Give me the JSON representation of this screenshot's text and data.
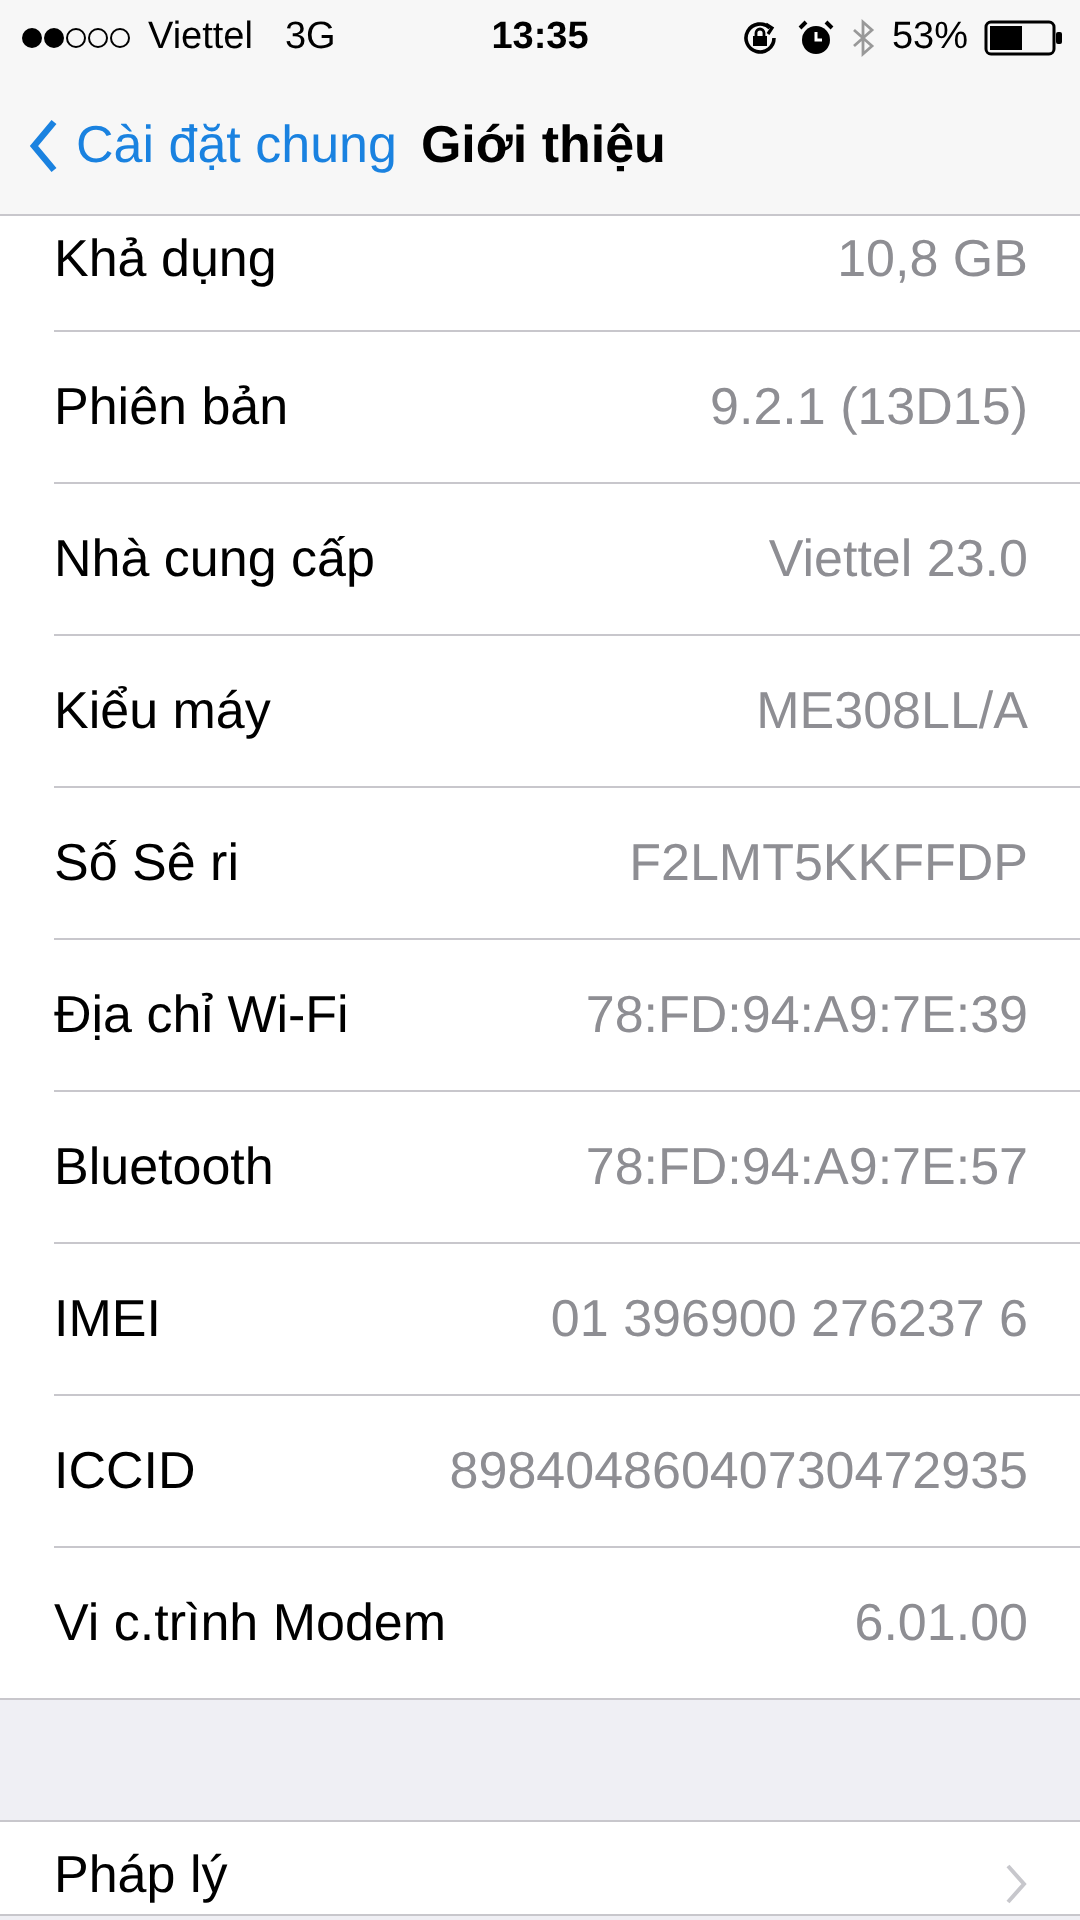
{
  "status_bar": {
    "carrier": "Viettel",
    "network": "3G",
    "time": "13:35",
    "battery": "53%"
  },
  "nav": {
    "back": "Cài đặt chung",
    "title": "Giới thiệu"
  },
  "sections": [
    {
      "rows": [
        {
          "kind": "info",
          "label": "Khả dụng",
          "value": "10,8 GB"
        },
        {
          "kind": "info",
          "label": "Phiên bản",
          "value": "9.2.1 (13D15)"
        },
        {
          "kind": "info",
          "label": "Nhà cung cấp",
          "value": "Viettel 23.0"
        },
        {
          "kind": "info",
          "label": "Kiểu máy",
          "value": "ME308LL/A"
        },
        {
          "kind": "info",
          "label": "Số Sê ri",
          "value": "F2LMT5KKFFDP"
        },
        {
          "kind": "info",
          "label": "Địa chỉ Wi-Fi",
          "value": "78:FD:94:A9:7E:39"
        },
        {
          "kind": "info",
          "label": "Bluetooth",
          "value": "78:FD:94:A9:7E:57"
        },
        {
          "kind": "info",
          "label": "IMEI",
          "value": "01 396900 276237 6"
        },
        {
          "kind": "info",
          "label": "ICCID",
          "value": "89840486040730472935"
        },
        {
          "kind": "info",
          "label": "Vi c.trình Modem",
          "value": "6.01.00"
        }
      ]
    },
    {
      "rows": [
        {
          "kind": "link",
          "label": "Pháp lý"
        }
      ]
    }
  ]
}
